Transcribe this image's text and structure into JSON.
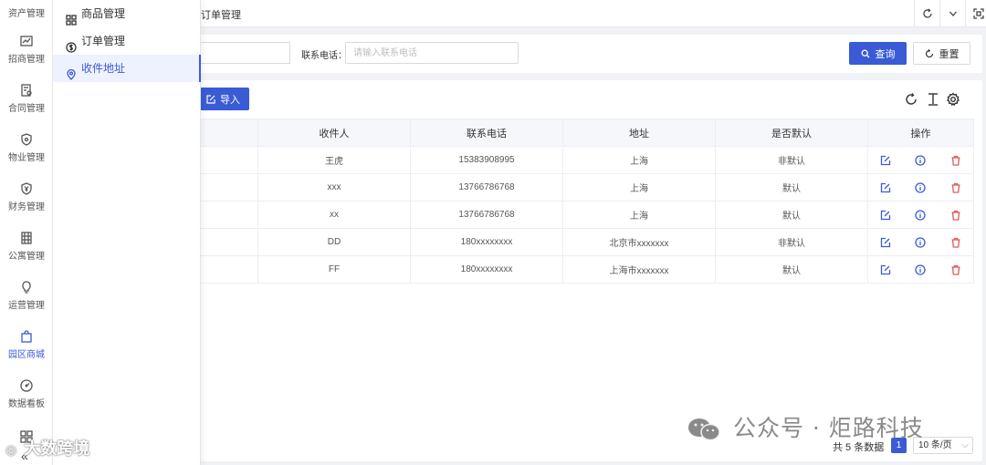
{
  "sidebar": {
    "top_label": "资产管理",
    "items": [
      {
        "label": "招商管理",
        "icon": "trend-chart-icon"
      },
      {
        "label": "合同管理",
        "icon": "contract-icon"
      },
      {
        "label": "物业管理",
        "icon": "shield-icon"
      },
      {
        "label": "财务管理",
        "icon": "yen-shield-icon"
      },
      {
        "label": "公寓管理",
        "icon": "building-icon"
      },
      {
        "label": "运营管理",
        "icon": "lightbulb-icon"
      },
      {
        "label": "园区商城",
        "icon": "shopping-bag-icon",
        "active": true
      },
      {
        "label": "数据看板",
        "icon": "dashboard-gauge-icon"
      }
    ],
    "collapse_icon": "double-chevron-left-icon"
  },
  "submenu": {
    "items": [
      {
        "label": "商品管理",
        "icon": "grid-icon"
      },
      {
        "label": "订单管理",
        "icon": "dollar-circle-icon"
      },
      {
        "label": "收件地址",
        "icon": "location-pin-icon",
        "active": true
      }
    ]
  },
  "topbar": {
    "tab_title": "订单管理",
    "buttons": [
      "refresh-icon",
      "chevron-down-icon",
      "fullscreen-icon"
    ]
  },
  "search": {
    "phone_label": "联系电话：",
    "phone_placeholder": "请输入联系电话",
    "query_label": "查询",
    "reset_label": "重置"
  },
  "toolbar": {
    "import_label": "导入"
  },
  "table": {
    "columns": [
      "收件人",
      "联系电话",
      "地址",
      "是否默认",
      "操作"
    ],
    "rows": [
      {
        "name": "王虎",
        "phone": "15383908995",
        "address": "上海",
        "default": "非默认"
      },
      {
        "name": "xxx",
        "phone": "13766786768",
        "address": "上海",
        "default": "默认"
      },
      {
        "name": "xx",
        "phone": "13766786768",
        "address": "上海",
        "default": "默认"
      },
      {
        "name": "DD",
        "phone": "180xxxxxxxx",
        "address": "北京市xxxxxxx",
        "default": "非默认"
      },
      {
        "name": "FF",
        "phone": "180xxxxxxxx",
        "address": "上海市xxxxxxx",
        "default": "默认"
      }
    ]
  },
  "pagination": {
    "total_text": "共 5 条数据",
    "current_page": "1",
    "page_size": "10 条/页"
  },
  "watermark": {
    "right": "公众号 · 炬路科技",
    "left": "大数跨境"
  },
  "colors": {
    "primary": "#3a5bd6",
    "delete": "#e05a5a",
    "edit": "#3a5bd6"
  }
}
